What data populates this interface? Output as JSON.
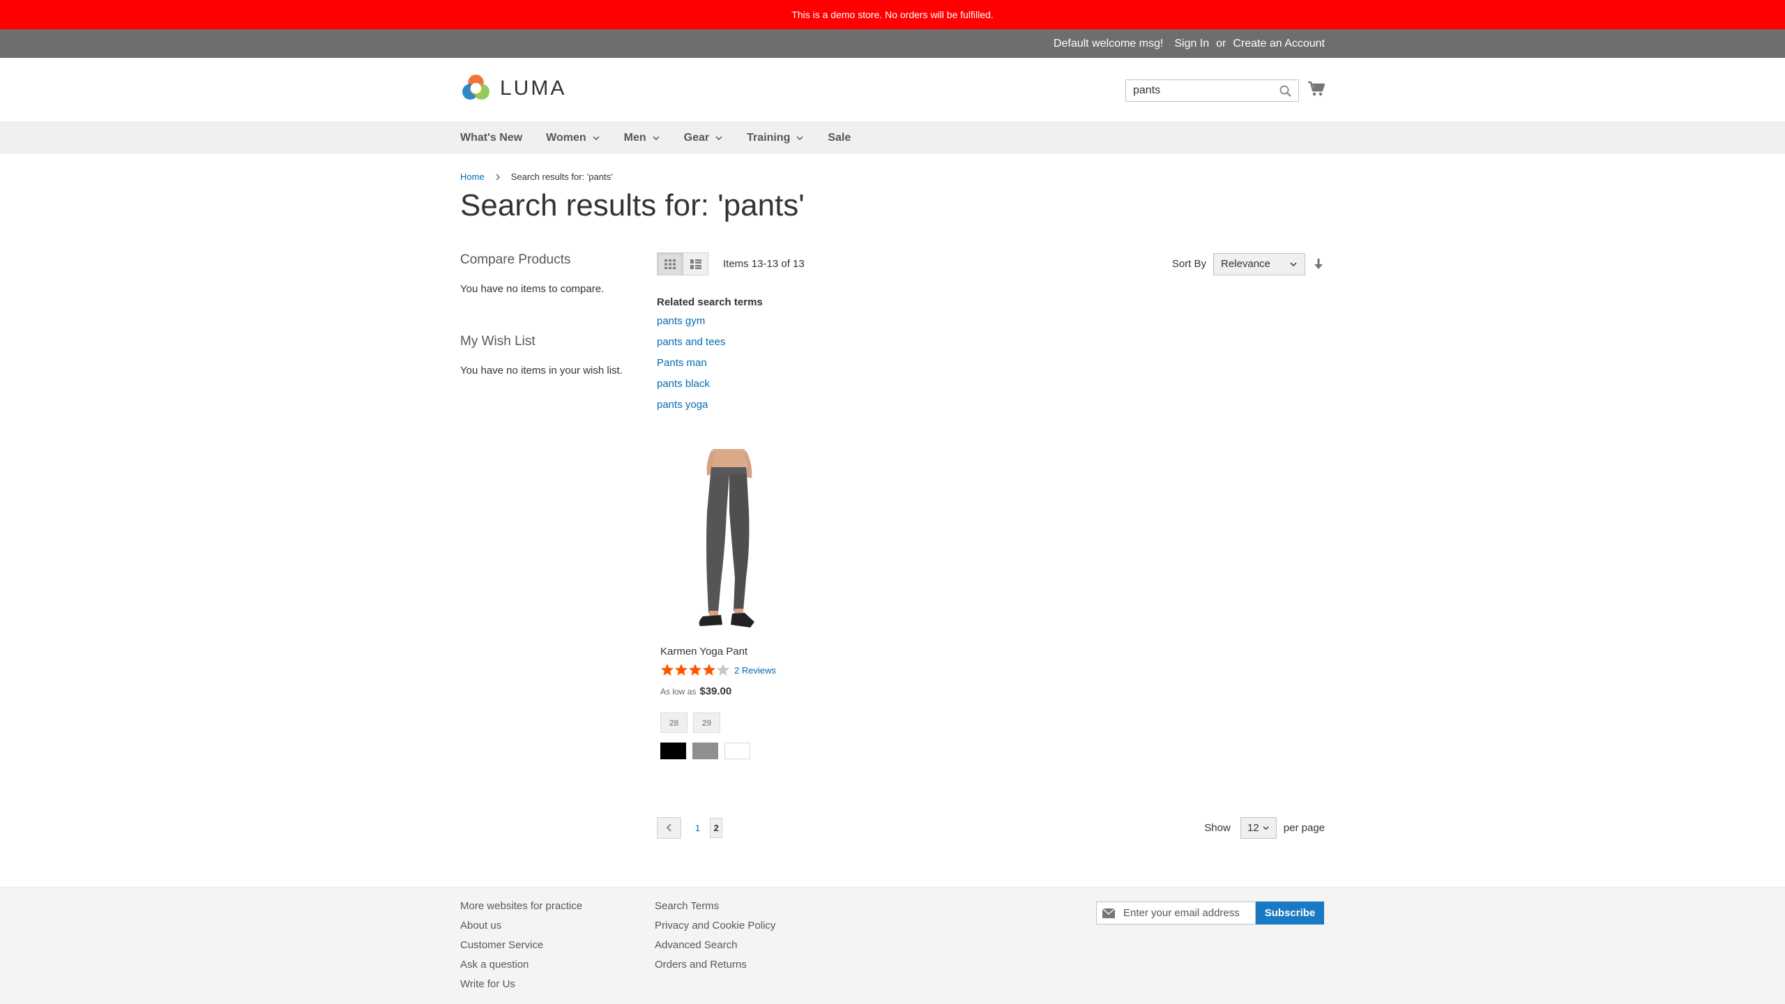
{
  "demo_notice": "This is a demo store. No orders will be fulfilled.",
  "top_links": {
    "welcome": "Default welcome msg!",
    "sign_in": "Sign In",
    "or": "or",
    "create_account": "Create an Account"
  },
  "logo": {
    "text": "LUMA",
    "icon": "luma-logo-icon"
  },
  "search": {
    "value": "pants",
    "icon": "search-icon"
  },
  "cart": {
    "icon": "cart-icon"
  },
  "nav": {
    "items": [
      {
        "label": "What's New",
        "has_submenu": false
      },
      {
        "label": "Women",
        "has_submenu": true
      },
      {
        "label": "Men",
        "has_submenu": true
      },
      {
        "label": "Gear",
        "has_submenu": true
      },
      {
        "label": "Training",
        "has_submenu": true
      },
      {
        "label": "Sale",
        "has_submenu": false
      }
    ]
  },
  "breadcrumbs": {
    "home": "Home",
    "current": "Search results for: 'pants'"
  },
  "page_title": "Search results for: 'pants'",
  "sidebar": {
    "compare_title": "Compare Products",
    "compare_empty": "You have no items to compare.",
    "wishlist_title": "My Wish List",
    "wishlist_empty": "You have no items in your wish list."
  },
  "toolbar": {
    "modes": [
      "grid-icon",
      "list-icon"
    ],
    "active_mode": "grid",
    "amount": "Items 13-13 of 13",
    "sort_label": "Sort By",
    "sort_value": "Relevance",
    "sort_direction_icon": "sort-arrow-down-icon"
  },
  "related": {
    "title": "Related search terms",
    "terms": [
      "pants gym",
      "pants and tees",
      "Pants man",
      "pants black",
      "pants yoga"
    ]
  },
  "product": {
    "name": "Karmen Yoga Pant",
    "rating_stars": 4,
    "rating_max": 5,
    "reviews": "2 Reviews",
    "price_label": "As low as",
    "price": "$39.00",
    "sizes": [
      "28",
      "29"
    ],
    "colors": [
      "#000000",
      "#8f8f8f",
      "#ffffff"
    ]
  },
  "pager": {
    "pages": [
      "1",
      "2"
    ],
    "current": "2",
    "show_label": "Show",
    "limit": "12",
    "per_page": "per page"
  },
  "footer": {
    "col1": [
      "More websites for practice",
      "About us",
      "Customer Service",
      "Ask a question",
      "Write for Us"
    ],
    "col2": [
      "Search Terms",
      "Privacy and Cookie Policy",
      "Advanced Search",
      "Orders and Returns"
    ],
    "newsletter_placeholder": "Enter your email address",
    "subscribe": "Subscribe"
  },
  "colors": {
    "link": "#006bb4",
    "subscribe": "#1979c3",
    "notice": "#ff0000",
    "star": "#ff5501"
  }
}
